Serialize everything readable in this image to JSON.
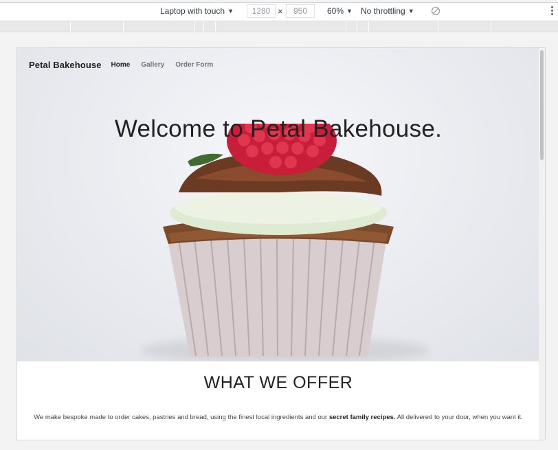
{
  "devtools": {
    "device": "Laptop with touch",
    "width": "1280",
    "height": "950",
    "zoom": "60%",
    "throttling": "No throttling"
  },
  "site": {
    "brand": "Petal Bakehouse",
    "nav": [
      {
        "label": "Home",
        "active": true
      },
      {
        "label": "Gallery",
        "active": false
      },
      {
        "label": "Order Form",
        "active": false
      }
    ],
    "hero_title": "Welcome to Petal Bakehouse.",
    "offer": {
      "title": "WHAT WE OFFER",
      "text_before": "We make bespoke made to order cakes, pastries and bread, using the finest local ingredients and our ",
      "text_bold": "secret family recipes.",
      "text_after": " All delivered to your door, when you want it."
    }
  }
}
